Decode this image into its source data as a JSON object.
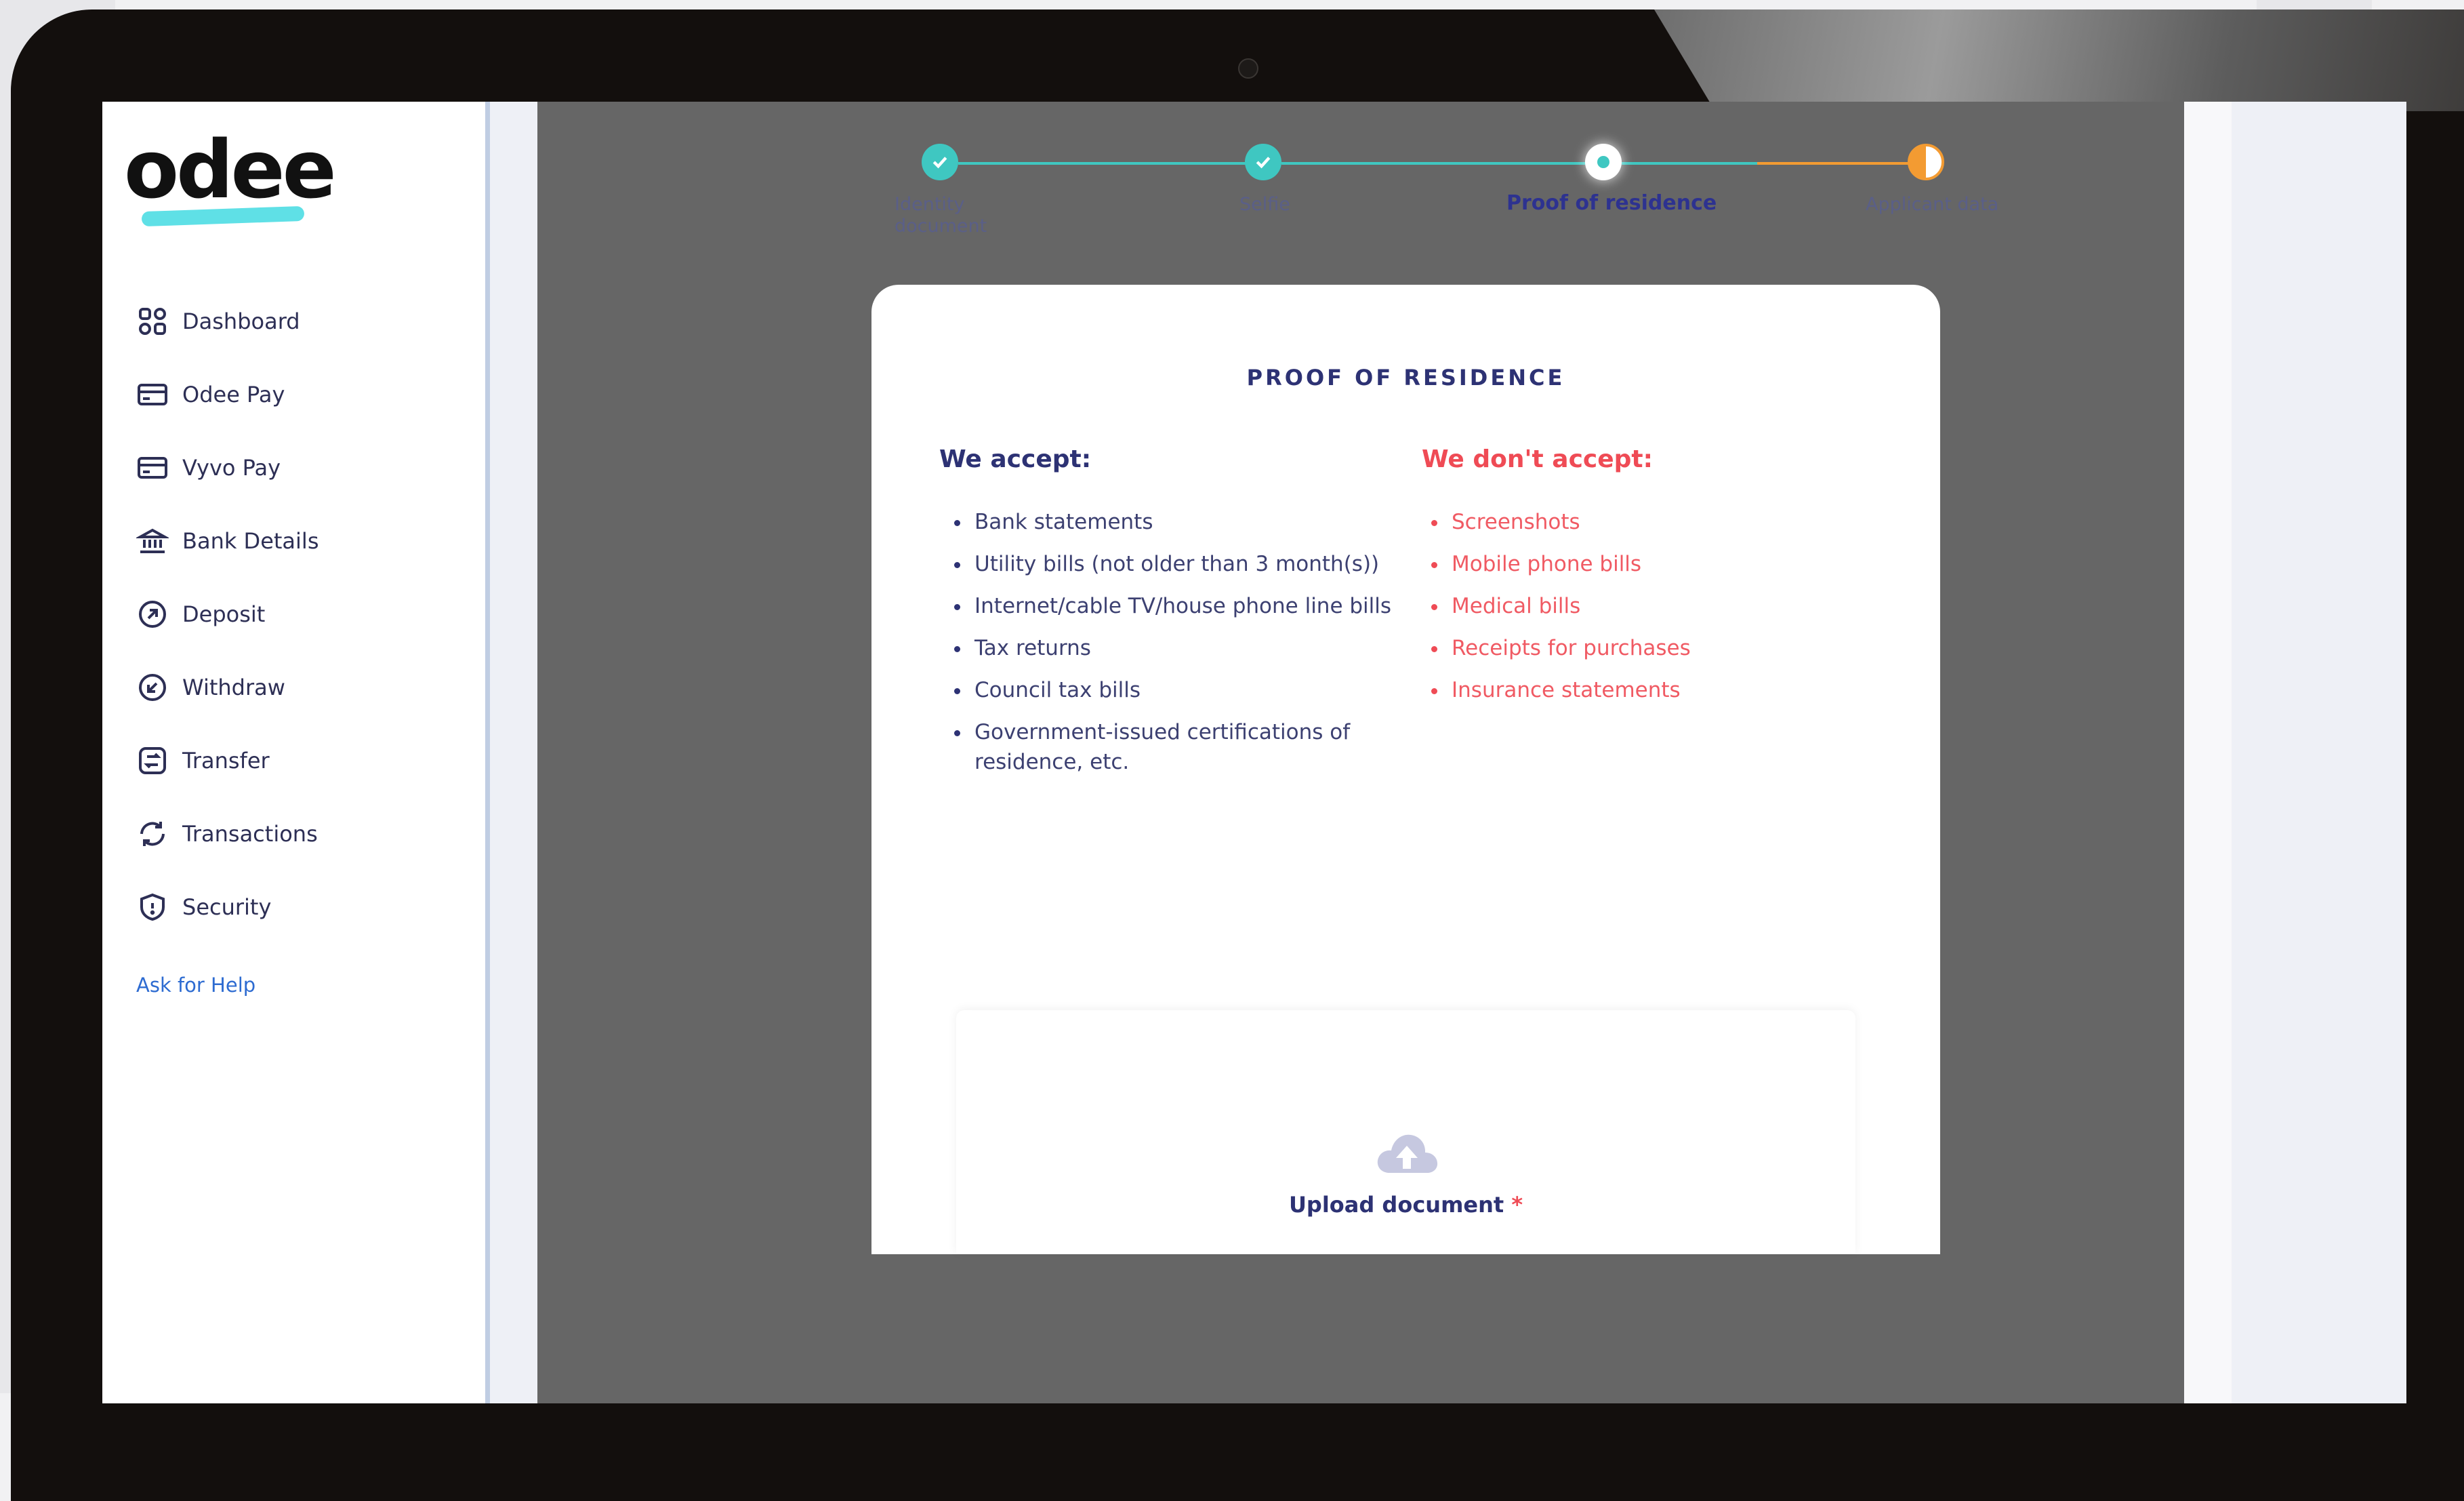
{
  "app": {
    "logo_text": "odee"
  },
  "sidebar": {
    "items": [
      {
        "label": "Dashboard",
        "icon": "grid-icon"
      },
      {
        "label": "Odee Pay",
        "icon": "card-icon"
      },
      {
        "label": "Vyvo Pay",
        "icon": "card-icon"
      },
      {
        "label": "Bank Details",
        "icon": "bank-icon"
      },
      {
        "label": "Deposit",
        "icon": "deposit-icon"
      },
      {
        "label": "Withdraw",
        "icon": "withdraw-icon"
      },
      {
        "label": "Transfer",
        "icon": "transfer-icon"
      },
      {
        "label": "Transactions",
        "icon": "refresh-icon"
      },
      {
        "label": "Security",
        "icon": "shield-icon"
      }
    ],
    "help_link": "Ask for Help"
  },
  "stepper": {
    "steps": [
      {
        "label": "Identity\ndocument",
        "state": "done"
      },
      {
        "label": "Selfie",
        "state": "done"
      },
      {
        "label": "Proof of residence",
        "state": "current"
      },
      {
        "label": "Applicant data",
        "state": "pending"
      }
    ]
  },
  "card": {
    "title": "PROOF OF RESIDENCE",
    "accept_heading": "We accept:",
    "accept_items": [
      "Bank statements",
      "Utility bills (not older than 3 month(s))",
      "Internet/cable TV/house phone line bills",
      "Tax returns",
      "Council tax bills",
      "Government-issued certifications of residence, etc."
    ],
    "reject_heading": "We don't accept:",
    "reject_items": [
      "Screenshots",
      "Mobile phone bills",
      "Medical bills",
      "Receipts for purchases",
      "Insurance statements"
    ],
    "upload_label": "Upload document",
    "upload_required_mark": "*"
  },
  "colors": {
    "brand_navy": "#2d3274",
    "teal": "#3fc7c1",
    "orange": "#f39b32",
    "reject_red": "#ef4b55",
    "overlay": "#666666"
  }
}
